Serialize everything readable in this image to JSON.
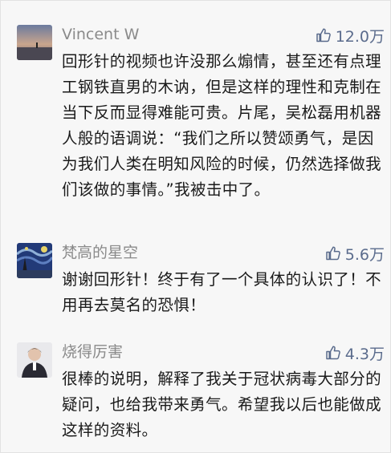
{
  "comments": [
    {
      "username": "Vincent W",
      "likes": "12.0万",
      "text": "回形针的视频也许没那么煽情，甚至还有点理工钢铁直男的木讷，但是这样的理性和克制在当下反而显得难能可贵。片尾，吴松磊用机器人般的语调说：“我们之所以赞颂勇气，是因为我们人类在明知风险的时候，仍然选择做我们该做的事情。”我被击中了。"
    },
    {
      "username": "梵高的星空",
      "likes": "5.6万",
      "text": "谢谢回形针！终于有了一个具体的认识了！不用再去莫名的恐惧！"
    },
    {
      "username": "烧得厉害",
      "likes": "4.3万",
      "text": "很棒的说明，解释了我关于冠状病毒大部分的疑问，也给我带来勇气。希望我以后也能做成这样的资料。"
    }
  ],
  "icons": {
    "like": "thumbs-up-icon",
    "like_color": "#5a6b8c"
  }
}
